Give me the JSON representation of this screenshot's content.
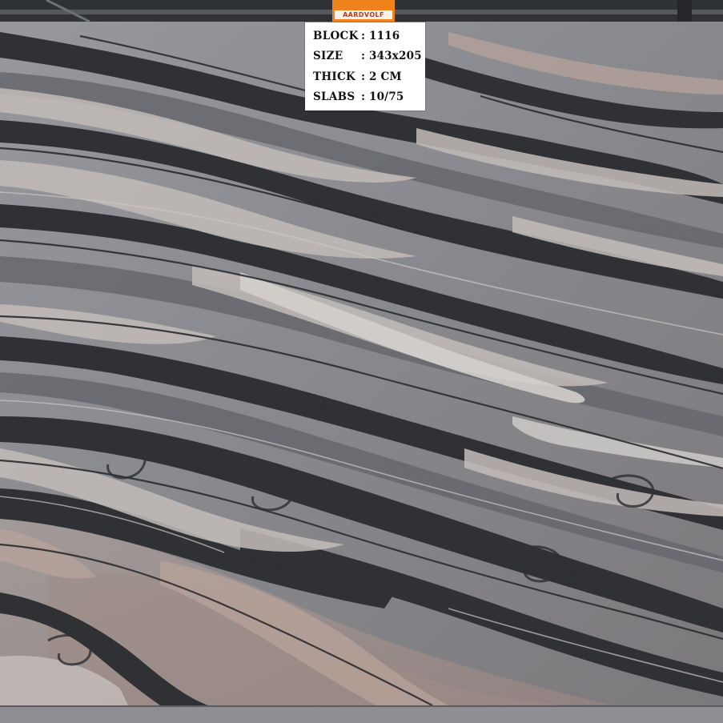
{
  "brand": {
    "logo_text": "AARDVOLF"
  },
  "slab_info": {
    "rows": [
      {
        "key": "BLOCK",
        "value": "1116"
      },
      {
        "key": "SIZE",
        "value": "343x205"
      },
      {
        "key": "THICK",
        "value": "2 CM"
      },
      {
        "key": "SLABS",
        "value": "10/75"
      }
    ]
  },
  "colors": {
    "background": "#3b3d40",
    "stone_light": "#c9c2c0",
    "stone_pink": "#cdb0a4",
    "stone_dark": "#14161b",
    "stone_grey": "#8a8c92",
    "tag_orange": "#f0841c"
  }
}
